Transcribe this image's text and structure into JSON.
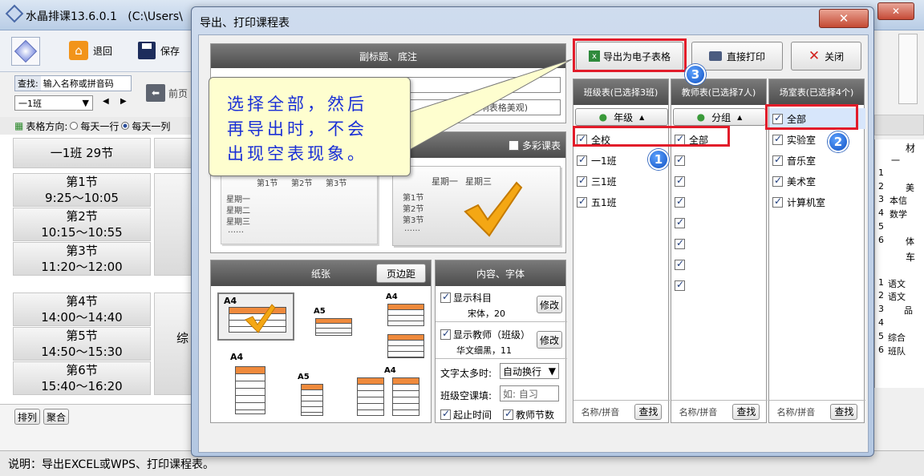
{
  "main_title": "水晶排课13.6.0.1   (C:\\Users\\",
  "toolbar": {
    "exit": "退回",
    "save": "保存"
  },
  "search": {
    "label": "查找:",
    "placeholder": "输入名称或拼音码",
    "class_select": "一1班",
    "prev_page": "前页"
  },
  "orientation": {
    "label": "表格方向:",
    "opt1": "每天一行",
    "opt2": "每天一列"
  },
  "schedule": {
    "header": "一1班 29节",
    "periods": [
      {
        "name": "第1节",
        "time": "9:25～10:05"
      },
      {
        "name": "第2节",
        "time": "10:15～10:55"
      },
      {
        "name": "第3节",
        "time": "11:20～12:00"
      },
      {
        "name": "第4节",
        "time": "14:00～14:40"
      },
      {
        "name": "第5节",
        "time": "14:50～15:30"
      },
      {
        "name": "第6节",
        "time": "15:40～16:20"
      }
    ],
    "side_text": "综"
  },
  "bottom_buttons": {
    "arrange": "排列",
    "merge": "聚合"
  },
  "status_bar": "说明：导出EXCEL或WPS、打印课程表。",
  "dialog": {
    "title": "导出、打印课程表",
    "export": "导出为电子表格",
    "print": "直接打印",
    "close": "关闭"
  },
  "subtitle_section": {
    "header": "副标题、底注",
    "hint": "字，以免影响表格美观)"
  },
  "tooltip": {
    "line1": "选择全部，然后",
    "line2": "再导出时，不会",
    "line3": "出现空表现象。"
  },
  "colorful": "多彩课表",
  "preview": {
    "days": [
      "星期一",
      "星期二",
      "星期三"
    ],
    "periods": [
      "第1节",
      "第2节",
      "第3节"
    ],
    "dots": "……"
  },
  "paper": {
    "header": "纸张",
    "margin_btn": "页边距",
    "sizes": {
      "a4": "A4",
      "a5": "A5"
    }
  },
  "content": {
    "header": "内容、字体",
    "show_subject": "显示科目",
    "subject_font": "宋体，20",
    "modify": "修改",
    "show_teacher": "显示教师（班级）",
    "teacher_font": "华文细黑，11",
    "overflow_label": "文字太多时:",
    "overflow_value": "自动换行",
    "empty_label": "班级空课填:",
    "empty_placeholder": "如: 自习",
    "start_end": "起止时间",
    "teacher_count": "教师节数"
  },
  "class_panel": {
    "header": "班级表(已选择3班)",
    "filter": "年级",
    "items": [
      {
        "label": "全校",
        "checked": true
      },
      {
        "label": "一1班",
        "checked": true
      },
      {
        "label": "三1班",
        "checked": true
      },
      {
        "label": "五1班",
        "checked": true
      }
    ]
  },
  "teacher_panel": {
    "header": "教师表(已选择7人)",
    "filter": "分组",
    "items": [
      {
        "label": "全部",
        "checked": true
      }
    ],
    "extra_checks": 7
  },
  "room_panel": {
    "header": "场室表(已选择4个)",
    "items": [
      {
        "label": "全部",
        "checked": true
      },
      {
        "label": "实验室",
        "checked": true
      },
      {
        "label": "音乐室",
        "checked": true
      },
      {
        "label": "美术室",
        "checked": true
      },
      {
        "label": "计算机室",
        "checked": true
      }
    ]
  },
  "panel_footer": {
    "name_pinyin": "名称/拼音",
    "find": "查找"
  },
  "badges": [
    "1",
    "2",
    "3"
  ],
  "right_grid": {
    "col_head": "材",
    "col_head2": "车",
    "row_nums": [
      "1",
      "2",
      "3",
      "4",
      "5",
      "6"
    ],
    "row_nums2": [
      "1",
      "2",
      "3",
      "4",
      "5",
      "6"
    ],
    "frag": [
      "美",
      "本信",
      "数学",
      "",
      "",
      "体"
    ],
    "frag2": [
      "语文",
      "语文",
      "品",
      "",
      "综合",
      "班队"
    ],
    "top": "一"
  },
  "colors": {
    "accent_red": "#e21c2a",
    "badge_blue": "#0e4fc2",
    "tooltip_bg": "#fefecf",
    "tooltip_text": "#1a2fd6"
  }
}
